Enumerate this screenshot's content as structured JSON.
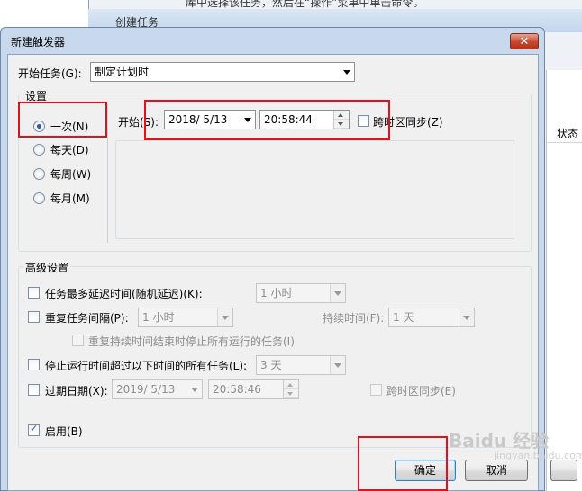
{
  "background_window": {
    "top_text": "库中选择该任务，然后在“操作”菜单中单击命令。",
    "title": "创建任务",
    "column_header": "状态"
  },
  "dialog": {
    "title": "新建触发器",
    "close_glyph": "✕",
    "start_task": {
      "label": "开始任务(G):",
      "value": "制定计划时"
    },
    "settings": {
      "title": "设置",
      "radios": [
        {
          "label": "一次(N)",
          "selected": true
        },
        {
          "label": "每天(D)",
          "selected": false
        },
        {
          "label": "每周(W)",
          "selected": false
        },
        {
          "label": "每月(M)",
          "selected": false
        }
      ],
      "start_label": "开始(S):",
      "start_date": "2018/  5/13",
      "start_time": "20:58:44",
      "sync_timezone_label": "跨时区同步(Z)"
    },
    "advanced": {
      "title": "高级设置",
      "delay": {
        "label": "任务最多延迟时间(随机延迟)(K):",
        "value": "1 小时"
      },
      "repeat": {
        "label": "重复任务间隔(P):",
        "value": "1 小时",
        "duration_label": "持续时间(F):",
        "duration_value": "1 天"
      },
      "stop_all_label": "重复持续时间结束时停止所有运行的任务(I)",
      "stop_longer": {
        "label": "停止运行时间超过以下时间的所有任务(L):",
        "value": "3 天"
      },
      "expire": {
        "label": "过期日期(X):",
        "date": "2019/  5/13",
        "time": "20:58:46",
        "sync_label": "跨时区同步(E)"
      },
      "enabled": {
        "label": "启用(B)",
        "checked": true
      }
    },
    "buttons": {
      "ok": "确定",
      "cancel": "取消"
    }
  },
  "watermark": {
    "text": "Baidu 经验",
    "url": "jingyan.baidu.com"
  },
  "colors": {
    "highlight_box": "#e0121e",
    "dialog_frame": "#c8d9ee",
    "client_bg": "#f0f0f0"
  }
}
